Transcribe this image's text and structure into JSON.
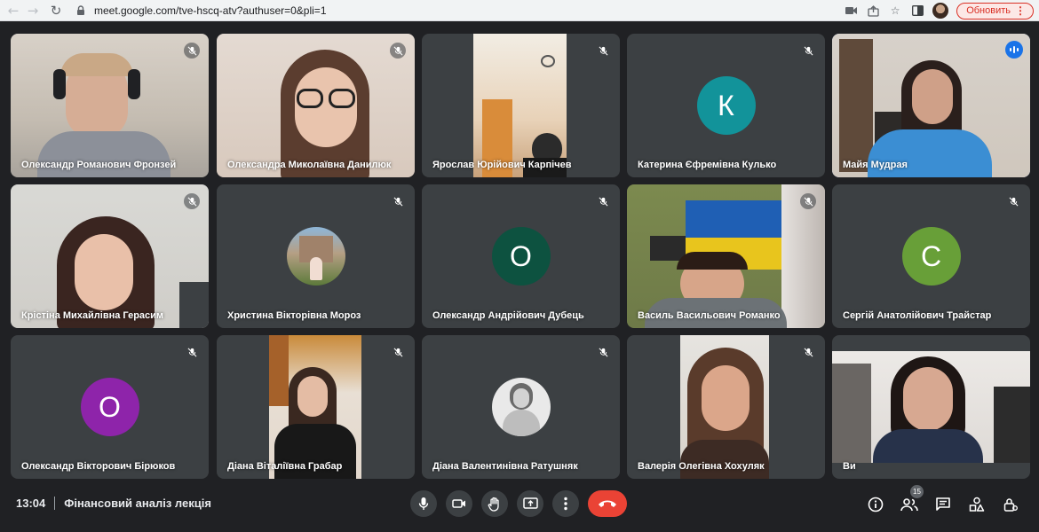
{
  "browser": {
    "url": "meet.google.com/tve-hscq-atv?authuser=0&pli=1",
    "update_label": "Обновить"
  },
  "participants": [
    {
      "name": "Олександр Романович Фронзей",
      "type": "video",
      "mic_muted": true
    },
    {
      "name": "Олександра Миколаївна Данилюк",
      "type": "video",
      "mic_muted": true
    },
    {
      "name": "Ярослав Юрійович Карпічев",
      "type": "video",
      "mic_muted": true
    },
    {
      "name": "Катерина Єфремівна Кулько",
      "type": "avatar",
      "initial": "К",
      "avatar_color": "#12939a",
      "mic_muted": true
    },
    {
      "name": "Майя Мудрая",
      "type": "video",
      "mic_muted": false,
      "speaking": true
    },
    {
      "name": "Крістіна Михайлівна Герасим",
      "type": "video",
      "mic_muted": true
    },
    {
      "name": "Христина Вікторівна Мороз",
      "type": "photo-avatar",
      "mic_muted": true
    },
    {
      "name": "Олександр Андрійович Дубець",
      "type": "avatar",
      "initial": "О",
      "avatar_color": "#0d5240",
      "mic_muted": true
    },
    {
      "name": "Василь Васильович Романко",
      "type": "video",
      "mic_muted": true
    },
    {
      "name": "Сергій Анатолійович Трайстар",
      "type": "avatar",
      "initial": "С",
      "avatar_color": "#689f38",
      "mic_muted": true
    },
    {
      "name": "Олександр Вікторович Бірюков",
      "type": "avatar",
      "initial": "О",
      "avatar_color": "#8e24aa",
      "mic_muted": true
    },
    {
      "name": "Діана Віталіївна Грабар",
      "type": "video",
      "mic_muted": true
    },
    {
      "name": "Діана Валентинівна Ратушняк",
      "type": "photo-avatar",
      "mic_muted": true
    },
    {
      "name": "Валерія Олегівна Хохуляк",
      "type": "video",
      "mic_muted": true
    },
    {
      "name": "Ви",
      "type": "video",
      "mic_muted": false
    }
  ],
  "bottom_bar": {
    "time": "13:04",
    "meeting_title": "Фінансовий аналіз лекція",
    "people_count": "15",
    "controls": [
      "mic-icon",
      "camera-icon",
      "raise-hand-icon",
      "present-icon",
      "more-icon",
      "end-call-icon"
    ],
    "right_icons": [
      "info-icon",
      "people-icon",
      "chat-icon",
      "activities-icon",
      "host-controls-icon"
    ]
  },
  "colors": {
    "background": "#202124",
    "tile": "#3c4043",
    "end_call": "#ea4335",
    "speaking": "#1a73e8"
  }
}
